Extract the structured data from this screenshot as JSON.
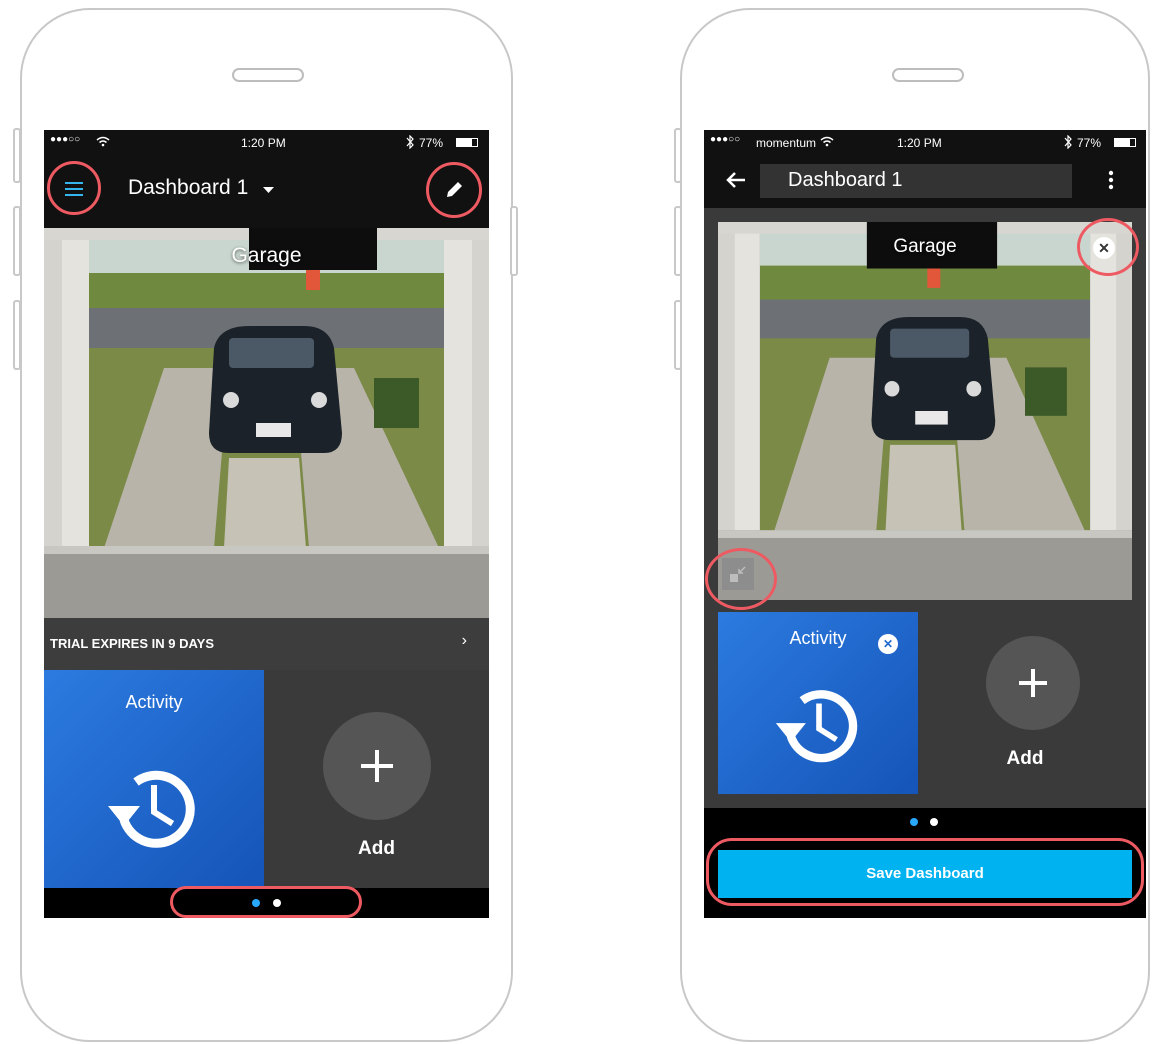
{
  "phone_left": {
    "status": {
      "signal": "●●●○○",
      "time": "1:20 PM",
      "battery": "77%"
    },
    "header": {
      "title": "Dashboard 1"
    },
    "camera": {
      "title": "Garage"
    },
    "trial": {
      "text": "TRIAL EXPIRES IN 9 DAYS",
      "arrow": "›"
    },
    "tiles": {
      "activity": "Activity",
      "add": "Add"
    },
    "pager": {
      "pages": 2,
      "active": 0
    }
  },
  "phone_right": {
    "status": {
      "signal": "●●●○○",
      "carrier": "momentum",
      "time": "1:20 PM",
      "battery": "77%"
    },
    "header": {
      "title": "Dashboard 1"
    },
    "camera": {
      "title": "Garage"
    },
    "tiles": {
      "activity": "Activity",
      "add": "Add"
    },
    "pager": {
      "pages": 2,
      "active": 0
    },
    "save_button": "Save Dashboard"
  },
  "colors": {
    "highlight": "#ee5a62",
    "accent_blue": "#00b2f0",
    "tile_blue": "#1f6ccc",
    "dot_active": "#29a8ff"
  },
  "icons": [
    "menu-icon",
    "dropdown-caret-icon",
    "pencil-icon",
    "back-arrow-icon",
    "kebab-menu-icon",
    "close-circle-icon",
    "collapse-icon",
    "history-clock-icon",
    "plus-icon",
    "wifi-icon",
    "bluetooth-icon",
    "battery-icon"
  ]
}
